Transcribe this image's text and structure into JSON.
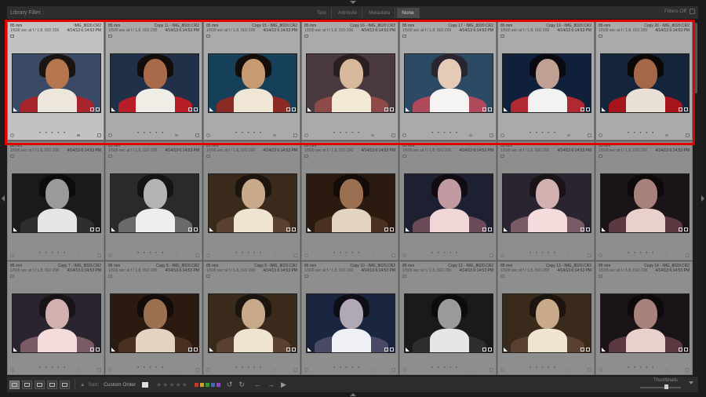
{
  "filter_bar": {
    "title": "Library Filter :",
    "tabs": [
      "Text",
      "Attribute",
      "Metadata",
      "None"
    ],
    "active_tab": "None",
    "right_label": "Filters Off"
  },
  "grid": {
    "rows": [
      {
        "cells": [
          {
            "lens": "85 mm",
            "file": "IMG_8020.CR2",
            "exposure": "1/500 sec at f / 1.8, ISO 200",
            "date": "4/14/13 6:14:53 PM",
            "tone": "color-warm",
            "selected": true
          },
          {
            "lens": "85 mm",
            "file": "Copy 11 - IMG_8020.CR2",
            "exposure": "1/500 sec at f / 1.8, ISO 200",
            "date": "4/14/13 6:14:53 PM",
            "tone": "color-vivid",
            "selected": true
          },
          {
            "lens": "85 mm",
            "file": "Copy 15 - IMG_8020.CR2",
            "exposure": "1/500 sec at f / 1.8, ISO 200",
            "date": "4/14/13 6:14:53 PM",
            "tone": "teal-warm",
            "selected": true
          },
          {
            "lens": "85 mm",
            "file": "Copy 16 - IMG_8020.CR2",
            "exposure": "1/500 sec at f / 1.8, ISO 200",
            "date": "4/14/13 6:14:53 PM",
            "tone": "faded-warm",
            "selected": true
          },
          {
            "lens": "85 mm",
            "file": "Copy 17 - IMG_8020.CR2",
            "exposure": "1/500 sec at f / 1.8, ISO 200",
            "date": "4/14/13 6:14:53 PM",
            "tone": "bright-cool",
            "selected": true
          },
          {
            "lens": "85 mm",
            "file": "Copy 19 - IMG_8020.CR2",
            "exposure": "1/500 sec at f / 1.8, ISO 200",
            "date": "4/14/13 6:14:53 PM",
            "tone": "cool-contrast",
            "selected": true
          },
          {
            "lens": "85 mm",
            "file": "Copy 20 - IMG_8020.CR2",
            "exposure": "1/500 sec at f / 1.8, ISO 200",
            "date": "4/14/13 6:14:53 PM",
            "tone": "color-deep",
            "selected": true
          }
        ]
      },
      {
        "cells": [
          {
            "lens": "85 mm",
            "file": "",
            "exposure": "1/500 sec at f / 1.8, ISO 200",
            "date": "4/14/13 6:14:53 PM",
            "tone": "bw-contrast",
            "selected": false
          },
          {
            "lens": "85 mm",
            "file": "",
            "exposure": "1/500 sec at f / 1.8, ISO 200",
            "date": "4/14/13 6:14:53 PM",
            "tone": "bw-soft",
            "selected": false
          },
          {
            "lens": "85 mm",
            "file": "",
            "exposure": "1/500 sec at f / 1.8, ISO 200",
            "date": "4/14/13 6:14:53 PM",
            "tone": "sepia-light",
            "selected": false
          },
          {
            "lens": "85 mm",
            "file": "",
            "exposure": "1/500 sec at f / 1.8, ISO 200",
            "date": "4/14/13 6:14:53 PM",
            "tone": "sepia-dark",
            "selected": false
          },
          {
            "lens": "85 mm",
            "file": "",
            "exposure": "1/500 sec at f / 1.8, ISO 200",
            "date": "4/14/13 6:14:53 PM",
            "tone": "rose-cool",
            "selected": false
          },
          {
            "lens": "85 mm",
            "file": "",
            "exposure": "1/500 sec at f / 1.8, ISO 200",
            "date": "4/14/13 6:14:53 PM",
            "tone": "rose-light",
            "selected": false
          },
          {
            "lens": "85 mm",
            "file": "",
            "exposure": "1/500 sec at f / 1.8, ISO 200",
            "date": "4/14/13 6:14:53 PM",
            "tone": "rose-dark",
            "selected": false
          }
        ]
      },
      {
        "cells": [
          {
            "lens": "85 mm",
            "file": "Copy 7 - IMG_8020.CR2",
            "exposure": "1/500 sec at f / 1.8, ISO 200",
            "date": "4/14/13 6:14:53 PM",
            "tone": "rose-light",
            "selected": false
          },
          {
            "lens": "85 mm",
            "file": "Copy 8 - IMG_8020.CR2",
            "exposure": "1/500 sec at f / 1.8, ISO 200",
            "date": "4/14/13 6:14:53 PM",
            "tone": "sepia-dark",
            "selected": false
          },
          {
            "lens": "85 mm",
            "file": "Copy 9 - IMG_8020.CR2",
            "exposure": "1/500 sec at f / 1.8, ISO 200",
            "date": "4/14/13 6:14:53 PM",
            "tone": "sepia-light",
            "selected": false
          },
          {
            "lens": "85 mm",
            "file": "Copy 10 - IMG_8020.CR2",
            "exposure": "1/500 sec at f / 1.8, ISO 200",
            "date": "4/14/13 6:14:53 PM",
            "tone": "cool-blue",
            "selected": false
          },
          {
            "lens": "85 mm",
            "file": "Copy 12 - IMG_8020.CR2",
            "exposure": "1/500 sec at f / 1.8, ISO 200",
            "date": "4/14/13 6:14:53 PM",
            "tone": "bw-contrast",
            "selected": false
          },
          {
            "lens": "85 mm",
            "file": "Copy 13 - IMG_8020.CR2",
            "exposure": "1/500 sec at f / 1.8, ISO 200",
            "date": "4/14/13 6:14:53 PM",
            "tone": "sepia-light",
            "selected": false
          },
          {
            "lens": "85 mm",
            "file": "Copy 14 - IMG_8020.CR2",
            "exposure": "1/500 sec at f / 1.8, ISO 200",
            "date": "4/14/13 6:14:53 PM",
            "tone": "rose-dark",
            "selected": false
          }
        ]
      }
    ]
  },
  "tones": {
    "color-warm": {
      "bg": "#3a4a66",
      "skin": "#b67650",
      "hair": "#1c1410",
      "scarf": "#ece6dc",
      "shoulders": "#a8242c"
    },
    "color-vivid": {
      "bg": "#203048",
      "skin": "#a86a48",
      "hair": "#120c0a",
      "scarf": "#f0ece6",
      "shoulders": "#b81e26"
    },
    "teal-warm": {
      "bg": "#16405a",
      "skin": "#c89a72",
      "hair": "#140e0a",
      "scarf": "#efe6d6",
      "shoulders": "#8a2a24"
    },
    "faded-warm": {
      "bg": "#4a3a40",
      "skin": "#d8b89a",
      "hair": "#2a2020",
      "scarf": "#f2ead6",
      "shoulders": "#8e4a48"
    },
    "bright-cool": {
      "bg": "#2c4a64",
      "skin": "#e6cab8",
      "hair": "#2a2630",
      "scarf": "#f6f4f2",
      "shoulders": "#b04a5a"
    },
    "cool-contrast": {
      "bg": "#10203a",
      "skin": "#c0a092",
      "hair": "#0a0a10",
      "scarf": "#f2f2f2",
      "shoulders": "#b02832"
    },
    "color-deep": {
      "bg": "#14243a",
      "skin": "#a66648",
      "hair": "#0c0806",
      "scarf": "#e8e0d4",
      "shoulders": "#a6141c"
    },
    "bw-contrast": {
      "bg": "#1a1a1a",
      "skin": "#9a9a9a",
      "hair": "#0c0c0c",
      "scarf": "#e6e6e6",
      "shoulders": "#2e2e2e"
    },
    "bw-soft": {
      "bg": "#2a2a2a",
      "skin": "#b4b4b4",
      "hair": "#141414",
      "scarf": "#eeeeee",
      "shoulders": "#6a6a6a"
    },
    "sepia-light": {
      "bg": "#3a2a1c",
      "skin": "#c8aa8a",
      "hair": "#1c140e",
      "scarf": "#efe4d2",
      "shoulders": "#5a4030"
    },
    "sepia-dark": {
      "bg": "#2a1a10",
      "skin": "#9a7050",
      "hair": "#140c08",
      "scarf": "#e2d4c0",
      "shoulders": "#4a3020"
    },
    "rose-cool": {
      "bg": "#1c2030",
      "skin": "#c09aa0",
      "hair": "#100c12",
      "scarf": "#f0d6d6",
      "shoulders": "#6a4a56"
    },
    "rose-light": {
      "bg": "#2a2430",
      "skin": "#d2b0b0",
      "hair": "#1a1418",
      "scarf": "#f4dcdc",
      "shoulders": "#7a5a64"
    },
    "rose-dark": {
      "bg": "#1a1418",
      "skin": "#a8807c",
      "hair": "#0e0a0c",
      "scarf": "#ead0cc",
      "shoulders": "#5a3a40"
    },
    "cool-blue": {
      "bg": "#1a2640",
      "skin": "#b0a8b4",
      "hair": "#0e0e16",
      "scarf": "#eef0f4",
      "shoulders": "#4a4a66"
    }
  },
  "toolbar": {
    "sort_label": "Sort:",
    "sort_value": "Custom Order",
    "thumbnails_label": "Thumbnails",
    "stars": "★★★★★",
    "color_labels": [
      "#c0392b",
      "#d4a017",
      "#3a9a3a",
      "#3a6ac0",
      "#8a4ac0"
    ]
  }
}
